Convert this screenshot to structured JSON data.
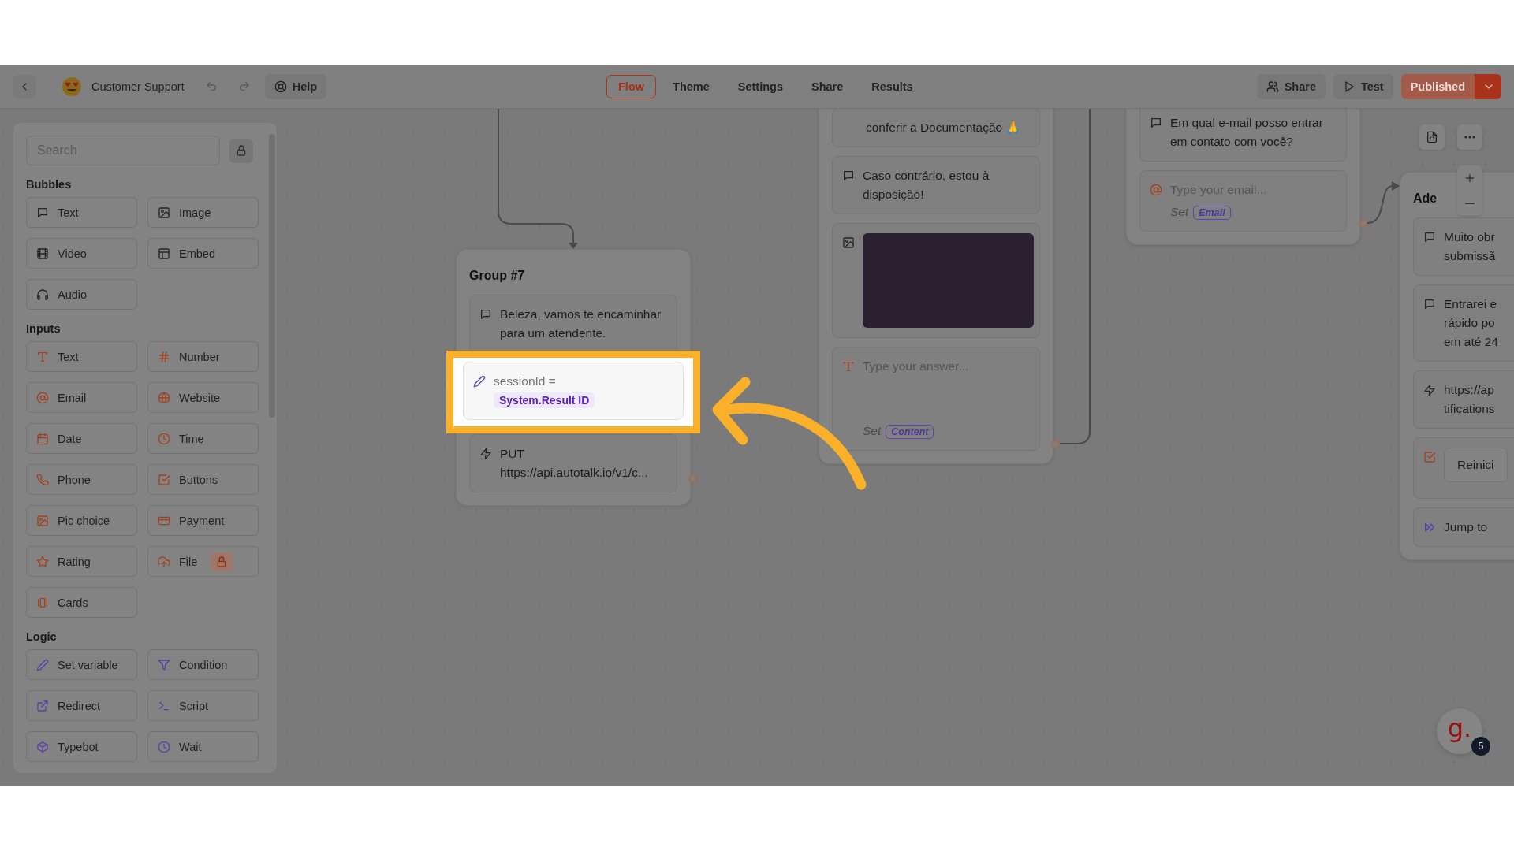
{
  "header": {
    "project_name": "Customer Support",
    "help": "Help",
    "tabs": [
      {
        "label": "Flow",
        "selected": true
      },
      {
        "label": "Theme",
        "selected": false
      },
      {
        "label": "Settings",
        "selected": false
      },
      {
        "label": "Share",
        "selected": false
      },
      {
        "label": "Results",
        "selected": false
      }
    ],
    "share": "Share",
    "test": "Test",
    "publish": {
      "label": "Published",
      "disabled": true
    }
  },
  "sidebar": {
    "search": {
      "placeholder": "Search"
    },
    "sections": [
      {
        "title": "Bubbles",
        "kind": "bubble",
        "items": [
          {
            "label": "Text",
            "locked": false
          },
          {
            "label": "Image",
            "locked": false
          },
          {
            "label": "Video",
            "locked": false
          },
          {
            "label": "Embed",
            "locked": false
          },
          {
            "label": "Audio",
            "locked": false
          }
        ]
      },
      {
        "title": "Inputs",
        "kind": "input",
        "items": [
          {
            "label": "Text",
            "locked": false
          },
          {
            "label": "Number",
            "locked": false
          },
          {
            "label": "Email",
            "locked": false
          },
          {
            "label": "Website",
            "locked": false
          },
          {
            "label": "Date",
            "locked": false
          },
          {
            "label": "Time",
            "locked": false
          },
          {
            "label": "Phone",
            "locked": false
          },
          {
            "label": "Buttons",
            "locked": false
          },
          {
            "label": "Pic choice",
            "locked": false
          },
          {
            "label": "Payment",
            "locked": false
          },
          {
            "label": "Rating",
            "locked": false
          },
          {
            "label": "File",
            "locked": true
          },
          {
            "label": "Cards",
            "locked": false
          }
        ]
      },
      {
        "title": "Logic",
        "kind": "logic",
        "items": [
          {
            "label": "Set variable",
            "locked": false
          },
          {
            "label": "Condition",
            "locked": false
          },
          {
            "label": "Redirect",
            "locked": false
          },
          {
            "label": "Script",
            "locked": false
          },
          {
            "label": "Typebot",
            "locked": false
          },
          {
            "label": "Wait",
            "locked": false
          }
        ]
      }
    ]
  },
  "canvas": {
    "groups": [
      {
        "title": "Group #7",
        "blocks": [
          {
            "kind": "text",
            "lines": [
              "Beleza, vamos te encaminhar para um atendente."
            ],
            "highlighted": false
          },
          {
            "kind": "set_variable",
            "variable": "sessionId =",
            "value": "System.Result ID",
            "highlighted": true
          },
          {
            "kind": "webhook",
            "lines": [
              "PUT",
              "https://api.autotalk.io/v1/c..."
            ],
            "highlighted": false
          }
        ]
      },
      {
        "blocks": [
          {
            "kind": "text_continued",
            "lines": [
              "conferir a Documentação 🙏"
            ],
            "highlighted": false
          },
          {
            "kind": "text",
            "lines": [
              "Caso contrário, estou à disposição!"
            ],
            "highlighted": false
          },
          {
            "kind": "image",
            "highlighted": false
          },
          {
            "kind": "text_input",
            "placeholder": "Type your answer...",
            "set_label": "Set",
            "variable": "Content",
            "highlighted": false
          }
        ]
      },
      {
        "blocks": [
          {
            "kind": "text",
            "lines": [
              "Em qual e-mail posso entrar em contato com você?"
            ],
            "highlighted": false
          },
          {
            "kind": "email_input",
            "placeholder": "Type your email...",
            "set_label": "Set",
            "variable": "Email",
            "highlighted": false
          }
        ]
      },
      {
        "title": "Ade",
        "blocks": [
          {
            "kind": "text",
            "lines": [
              "Muito obr",
              "submissã"
            ],
            "highlighted": false
          },
          {
            "kind": "text",
            "lines": [
              "Entrarei e",
              "rápido po",
              "em até 24"
            ],
            "highlighted": false
          },
          {
            "kind": "webhook",
            "lines": [
              "https://ap",
              "tifications"
            ],
            "highlighted": false
          },
          {
            "kind": "buttons",
            "button": "Reinici",
            "highlighted": false
          },
          {
            "kind": "jump",
            "label": "Jump to",
            "highlighted": false
          }
        ]
      }
    ]
  },
  "chat_widget": {
    "logo": "g.",
    "badge": "5"
  }
}
